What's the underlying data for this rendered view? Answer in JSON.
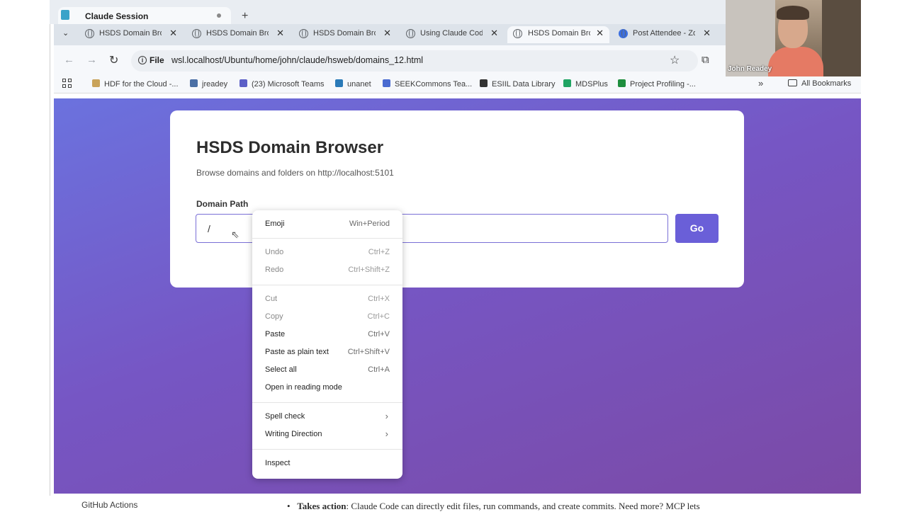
{
  "session": {
    "tab_label": "Claude Session",
    "new_tab": "+"
  },
  "tabs": [
    {
      "label": "HSDS Domain Browser",
      "active": false
    },
    {
      "label": "HSDS Domain Browser",
      "active": false
    },
    {
      "label": "HSDS Domain Browser",
      "active": false
    },
    {
      "label": "Using Claude Code",
      "active": false
    },
    {
      "label": "HSDS Domain Browser",
      "active": true
    },
    {
      "label": "Post Attendee - Zoom",
      "active": false
    }
  ],
  "address_bar": {
    "scheme_label": "File",
    "url": "wsl.localhost/Ubuntu/home/john/claude/hsweb/domains_12.html"
  },
  "bookmarks": {
    "items": [
      {
        "label": "HDF for the Cloud -...",
        "color": "#c9a35a"
      },
      {
        "label": "jreadey",
        "color": "#4a6fa5"
      },
      {
        "label": "(23) Microsoft Teams",
        "color": "#5b5fc7"
      },
      {
        "label": "unanet",
        "color": "#2a7ab8"
      },
      {
        "label": "SEEKCommons Tea...",
        "color": "#4a6bd1"
      },
      {
        "label": "ESIIL Data Library",
        "color": "#333333"
      },
      {
        "label": "MDSPlus",
        "color": "#1fa463"
      },
      {
        "label": "Project Profiling -...",
        "color": "#1e8e3e"
      }
    ],
    "more": "»",
    "all_bookmarks": "All Bookmarks"
  },
  "page": {
    "title": "HSDS Domain Browser",
    "subtitle": "Browse domains and folders on http://localhost:5101",
    "field_label": "Domain Path",
    "input_value": "/",
    "go_label": "Go"
  },
  "context_menu": {
    "items": [
      {
        "label": "Emoji",
        "shortcut": "Win+Period",
        "disabled": false
      },
      {
        "label": "Undo",
        "shortcut": "Ctrl+Z",
        "disabled": true
      },
      {
        "label": "Redo",
        "shortcut": "Ctrl+Shift+Z",
        "disabled": true
      },
      {
        "label": "Cut",
        "shortcut": "Ctrl+X",
        "disabled": true
      },
      {
        "label": "Copy",
        "shortcut": "Ctrl+C",
        "disabled": true
      },
      {
        "label": "Paste",
        "shortcut": "Ctrl+V",
        "disabled": false
      },
      {
        "label": "Paste as plain text",
        "shortcut": "Ctrl+Shift+V",
        "disabled": false
      },
      {
        "label": "Select all",
        "shortcut": "Ctrl+A",
        "disabled": false
      },
      {
        "label": "Open in reading mode",
        "shortcut": "",
        "disabled": false
      },
      {
        "label": "Spell check",
        "shortcut": "›",
        "disabled": false
      },
      {
        "label": "Writing Direction",
        "shortcut": "›",
        "disabled": false
      },
      {
        "label": "Inspect",
        "shortcut": "",
        "disabled": false
      }
    ]
  },
  "background": {
    "left_text": "GitHub Actions",
    "right_text_bold": "Takes action",
    "right_text": ": Claude Code can directly edit files, run commands, and create commits. Need more? MCP lets"
  },
  "webcam": {
    "name": "John Readey"
  }
}
